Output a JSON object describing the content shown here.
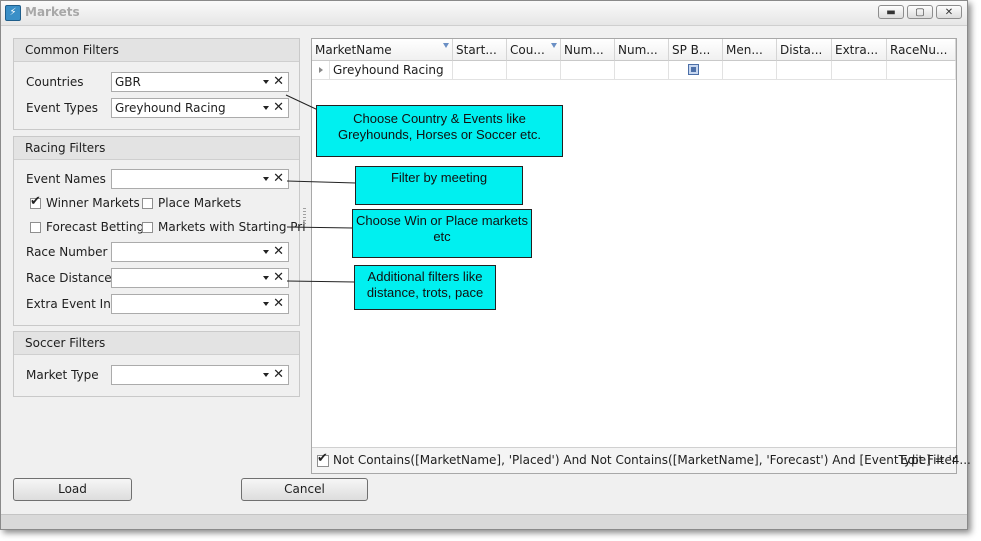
{
  "window": {
    "title": "Markets"
  },
  "common_filters": {
    "header": "Common Filters",
    "countries_label": "Countries",
    "countries_value": "GBR",
    "event_types_label": "Event Types",
    "event_types_value": "Greyhound Racing"
  },
  "racing_filters": {
    "header": "Racing Filters",
    "event_names_label": "Event Names",
    "event_names_value": "",
    "winner_markets_label": "Winner Markets",
    "winner_markets_checked": true,
    "place_markets_label": "Place Markets",
    "place_markets_checked": false,
    "forecast_betting_label": "Forecast Betting",
    "forecast_betting_checked": false,
    "starting_price_label": "Markets with Starting Pri",
    "starting_price_checked": false,
    "race_number_label": "Race Number",
    "race_distance_label": "Race Distance",
    "extra_event_info_label": "Extra Event Info"
  },
  "soccer_filters": {
    "header": "Soccer Filters",
    "market_type_label": "Market Type"
  },
  "grid": {
    "columns": [
      "MarketName",
      "Start...",
      "Cou...",
      "Num...",
      "Num...",
      "SP B...",
      "Men...",
      "Dista...",
      "Extra...",
      "RaceNu..."
    ],
    "rows": [
      {
        "market_name": "Greyhound Racing"
      }
    ],
    "filter_text": "Not Contains([MarketName], 'Placed') And Not Contains([MarketName], 'Forecast') And [EventType] = '4...",
    "filter_checked": true,
    "edit_filter_label": "Edit Filter"
  },
  "buttons": {
    "load": "Load",
    "cancel": "Cancel"
  },
  "callouts": {
    "country_events": "Choose Country & Events like Greyhounds, Horses or Soccer etc.",
    "meeting": "Filter by meeting",
    "win_place": "Choose Win or Place markets etc",
    "additional": "Additional filters like distance, trots, pace"
  },
  "colors": {
    "callout_bg": "#00f0f0",
    "window_bg": "#f0f0f0"
  }
}
